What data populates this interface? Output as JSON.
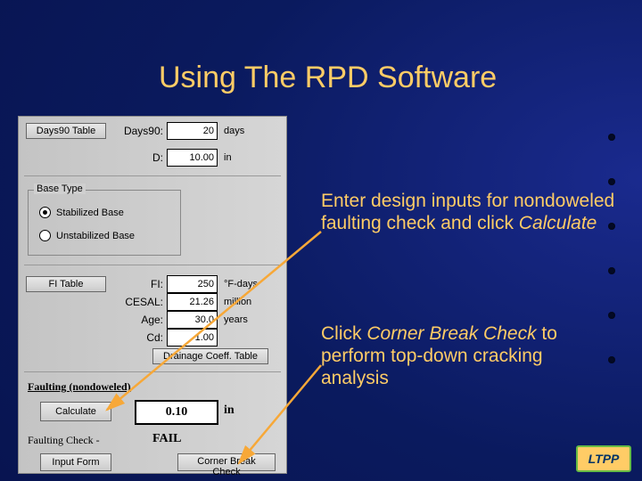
{
  "title": "Using The RPD Software",
  "panel": {
    "days90_btn": "Days90 Table",
    "days90_label": "Days90:",
    "days90_value": "20",
    "days90_unit": "days",
    "d_label": "D:",
    "d_value": "10.00",
    "d_unit": "in",
    "base_type_legend": "Base Type",
    "radio_stab": "Stabilized Base",
    "radio_unstab": "Unstabilized Base",
    "fi_btn": "FI Table",
    "fi_label": "FI:",
    "fi_value": "250",
    "fi_unit": "°F-days",
    "cesal_label": "CESAL:",
    "cesal_value": "21.26",
    "cesal_unit": "million",
    "age_label": "Age:",
    "age_value": "30.0",
    "age_unit": "years",
    "cd_label": "Cd:",
    "cd_value": "1.00",
    "drain_btn": "Drainage Coeff. Table",
    "faulting_header": "Faulting (nondoweled)",
    "calc_btn": "Calculate",
    "result_value": "0.10",
    "result_unit": "in",
    "check_label": "Faulting Check -",
    "check_result": "FAIL",
    "input_form_btn": "Input Form",
    "corner_btn": "Corner Break Check"
  },
  "instr1_a": "Enter design inputs for nondoweled faulting check and click ",
  "instr1_b": "Calculate",
  "instr2_a": "Click ",
  "instr2_b": "Corner Break Check",
  "instr2_c": " to perform top-down cracking analysis",
  "logo": "LTPP"
}
